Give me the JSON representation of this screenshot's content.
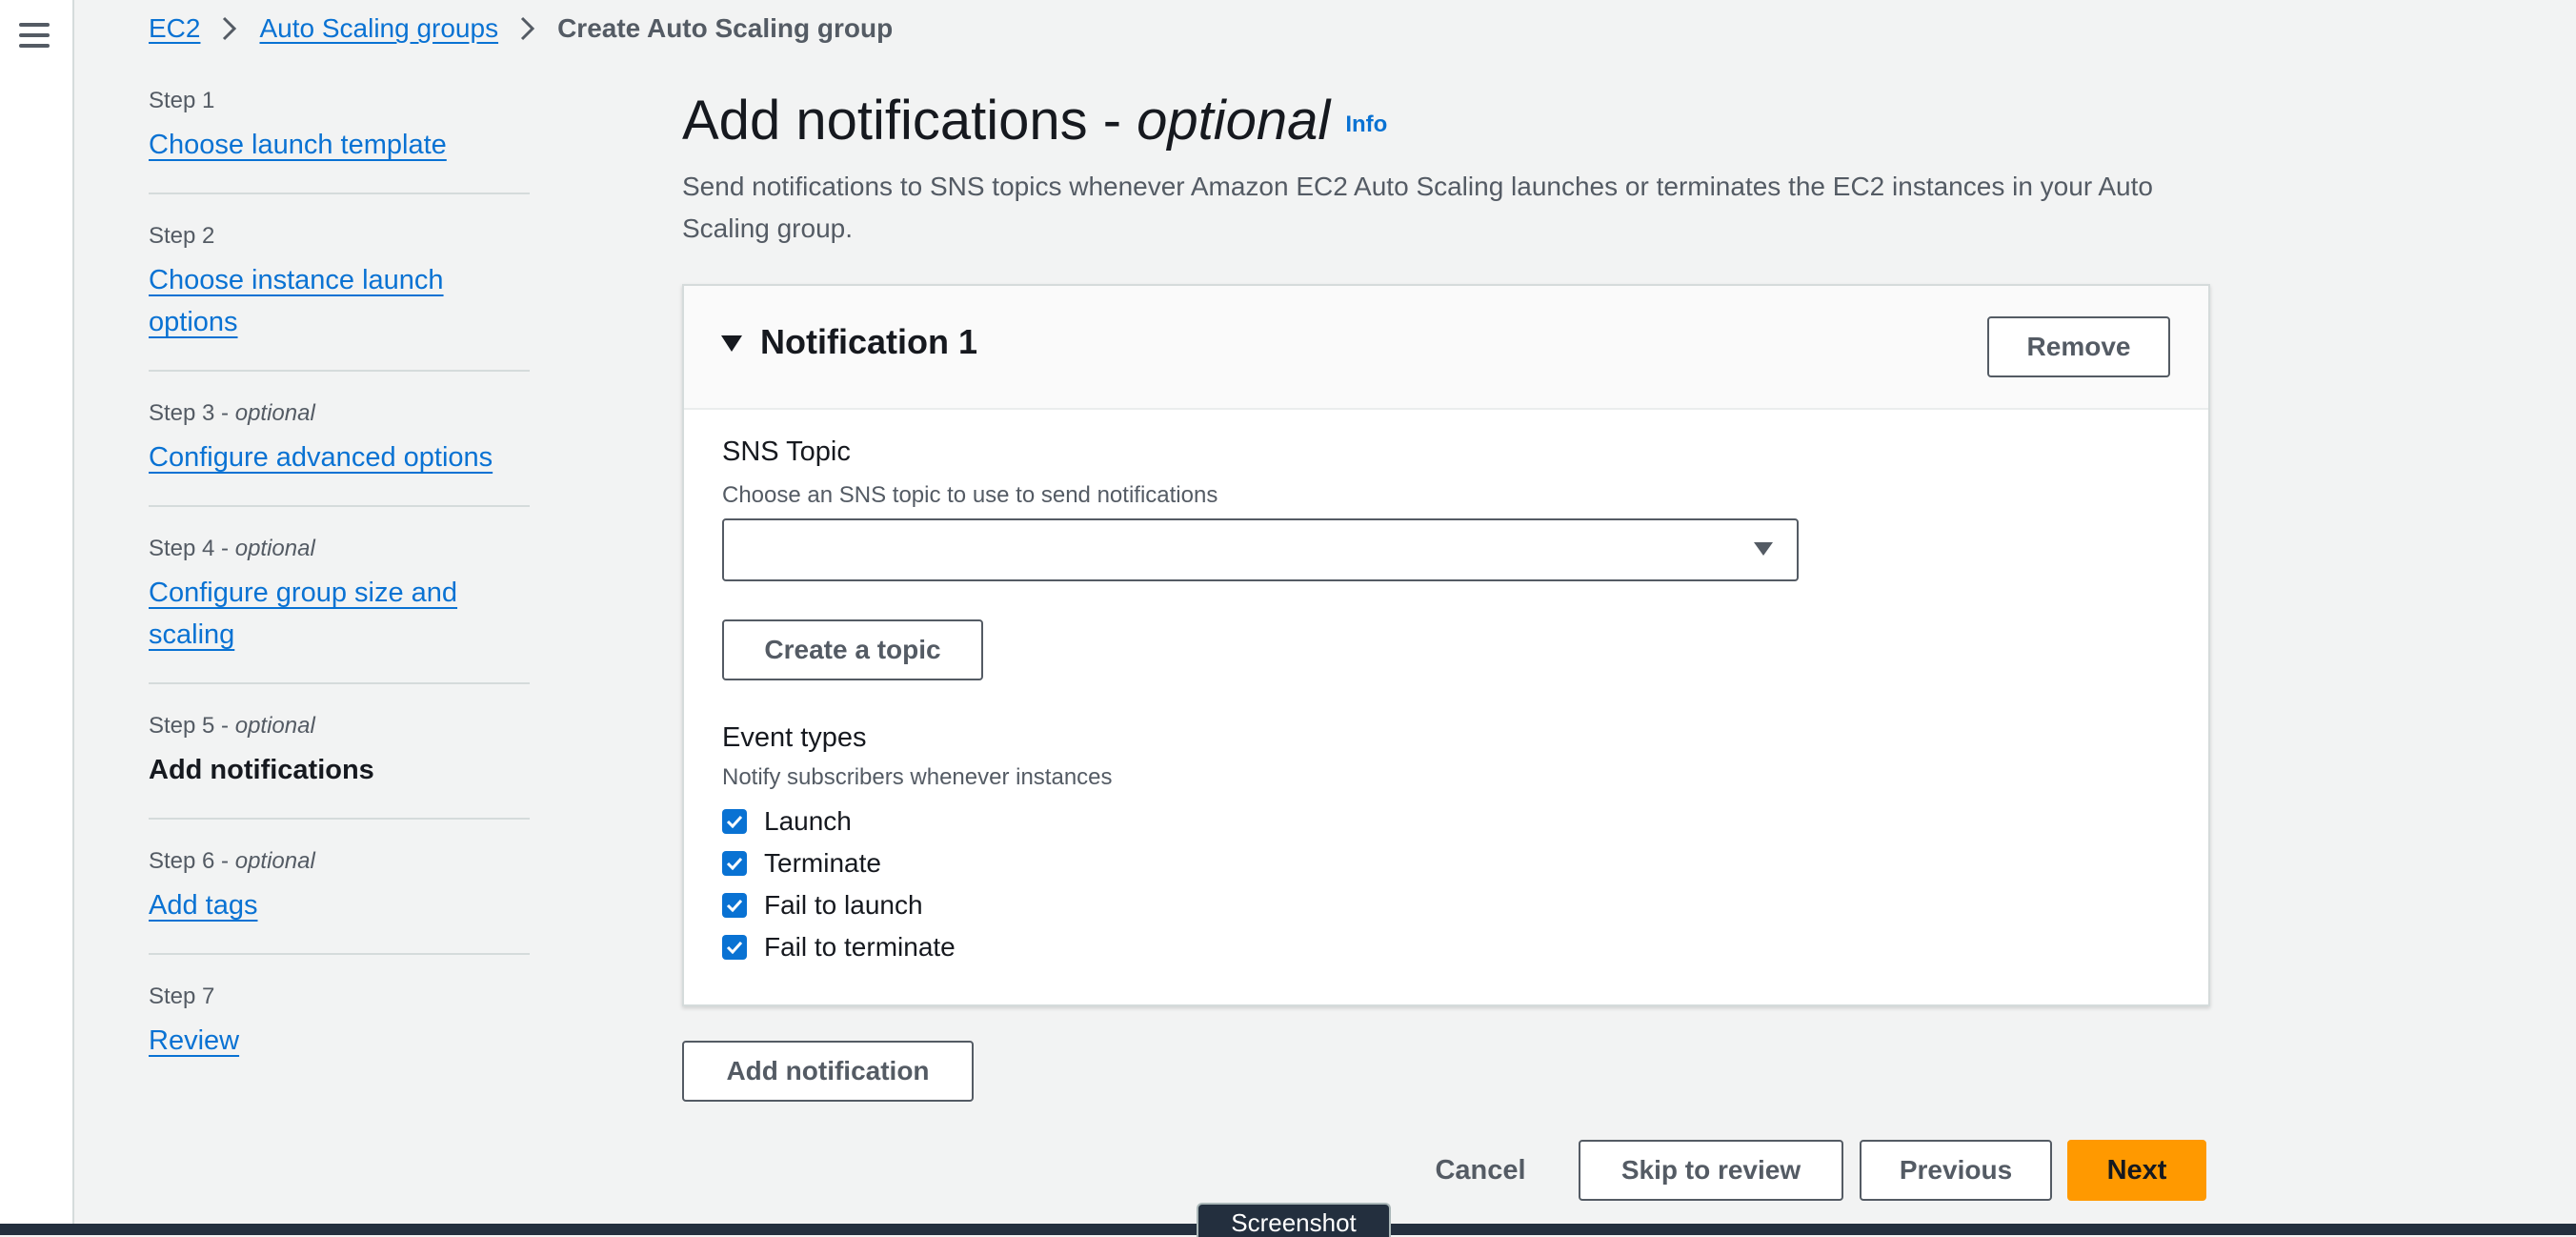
{
  "breadcrumb": {
    "items": [
      "EC2",
      "Auto Scaling groups"
    ],
    "current": "Create Auto Scaling group"
  },
  "steps": [
    {
      "number": "Step 1",
      "optional": "",
      "label": "Choose launch template"
    },
    {
      "number": "Step 2",
      "optional": "",
      "label": "Choose instance launch options"
    },
    {
      "number": "Step 3 - ",
      "optional": "optional",
      "label": "Configure advanced options"
    },
    {
      "number": "Step 4 - ",
      "optional": "optional",
      "label": "Configure group size and scaling"
    },
    {
      "number": "Step 5 - ",
      "optional": "optional",
      "label": "Add notifications"
    },
    {
      "number": "Step 6 - ",
      "optional": "optional",
      "label": "Add tags"
    },
    {
      "number": "Step 7",
      "optional": "",
      "label": "Review"
    }
  ],
  "page": {
    "title": "Add notifications - ",
    "title_optional": "optional",
    "info": "Info",
    "description": "Send notifications to SNS topics whenever Amazon EC2 Auto Scaling launches or terminates the EC2 instances in your Auto Scaling group."
  },
  "notification": {
    "title": "Notification 1",
    "remove_label": "Remove",
    "sns_label": "SNS Topic",
    "sns_description": "Choose an SNS topic to use to send notifications",
    "sns_value": "",
    "create_topic_label": "Create a topic",
    "event_types_label": "Event types",
    "event_types_description": "Notify subscribers whenever instances",
    "events": [
      {
        "label": "Launch",
        "checked": true
      },
      {
        "label": "Terminate",
        "checked": true
      },
      {
        "label": "Fail to launch",
        "checked": true
      },
      {
        "label": "Fail to terminate",
        "checked": true
      }
    ]
  },
  "add_notification_label": "Add notification",
  "footer": {
    "cancel": "Cancel",
    "skip": "Skip to review",
    "previous": "Previous",
    "next": "Next"
  },
  "screenshot_tab": "Screenshot",
  "colors": {
    "link": "#0972d3",
    "primary": "#ff9900",
    "background": "#f2f3f3",
    "checkbox": "#0972d3"
  }
}
